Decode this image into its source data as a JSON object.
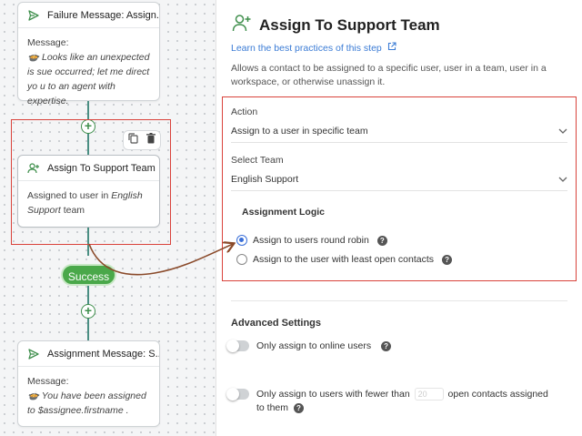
{
  "canvas": {
    "nodes": {
      "failure": {
        "title": "Failure Message: Assign...",
        "label": "Message:",
        "text": "🍲 Looks like an unexpected is sue occurred; let me direct yo u to an agent with expertise."
      },
      "assign": {
        "title": "Assign To Support Team",
        "text_prefix": "Assigned to user in ",
        "team": "English Support",
        "text_suffix": " team"
      },
      "assignment_msg": {
        "title": "Assignment Message: S...",
        "label": "Message:",
        "text_prefix": "🍲 You have been assigned to ",
        "variable": "$assignee.firstname",
        "text_suffix": " ."
      }
    },
    "success_label": "Success",
    "icons": [
      "send-icon",
      "user-plus-icon",
      "copy-icon",
      "trash-icon",
      "plus-icon"
    ]
  },
  "panel": {
    "title": "Assign To Support Team",
    "learn_link": "Learn the best practices of this step",
    "description": "Allows a contact to be assigned to a specific user, user in a team, user in a workspace, or otherwise unassign it.",
    "action": {
      "label": "Action",
      "value": "Assign to a user in specific team"
    },
    "team": {
      "label": "Select Team",
      "value": "English Support"
    },
    "logic": {
      "title": "Assignment Logic",
      "options": [
        {
          "label": "Assign to users round robin",
          "selected": true
        },
        {
          "label": "Assign to the user with least open contacts",
          "selected": false
        }
      ]
    },
    "advanced": {
      "title": "Advanced Settings",
      "online_only": "Only assign to online users",
      "fewer_prefix": "Only assign to users with fewer than",
      "fewer_placeholder": "20",
      "fewer_suffix": "open contacts assigned to them"
    }
  },
  "colors": {
    "accent": "#3a7bd5",
    "success": "#4aa84a",
    "highlight": "#d9423b",
    "connector": "#4a8f83"
  }
}
